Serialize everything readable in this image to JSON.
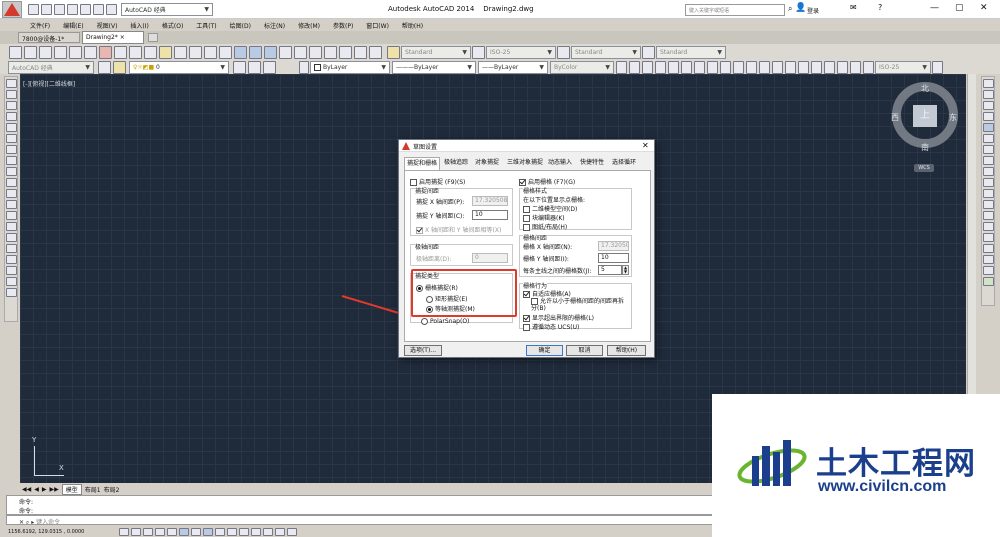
{
  "title_bar": {
    "app_title": "Autodesk AutoCAD 2014",
    "file_name": "Drawing2.dwg",
    "search_placeholder": "键入关键字或短语",
    "login_label": "登录"
  },
  "workspace_dropdown": "AutoCAD 经典",
  "menu": [
    "文件(F)",
    "编辑(E)",
    "视图(V)",
    "插入(I)",
    "格式(O)",
    "工具(T)",
    "绘图(D)",
    "标注(N)",
    "修改(M)",
    "参数(P)",
    "窗口(W)",
    "帮助(H)"
  ],
  "doc_tabs": [
    "7800@设备-1*",
    "Drawing2*"
  ],
  "styles_toolbar": {
    "text_style": "Standard",
    "dim_style": "ISO-25",
    "table_style": "Standard",
    "multileader_style": "Standard"
  },
  "layers_toolbar": {
    "workspace": "AutoCAD 经典",
    "layer": "0",
    "color": "ByLayer",
    "linetype": "ByLayer",
    "lineweight": "ByLayer",
    "plotstyle": "ByColor",
    "dim_style": "ISO-25"
  },
  "viewport_label": "[-][俯视][二维线框]",
  "viewcube": {
    "north": "北",
    "south": "南",
    "west": "西",
    "east": "东",
    "top": "上",
    "wcs": "WCS"
  },
  "ucs": {
    "x": "X",
    "y": "Y"
  },
  "layout_tabs": [
    "模型",
    "布局1",
    "布局2"
  ],
  "command_lines": [
    "命令:",
    "命令:"
  ],
  "command_prompt": "键入命令",
  "coordinates": "1156.6192, 129.0315 , 0.0000",
  "dialog": {
    "title": "草图设置",
    "tabs": [
      "捕捉和栅格",
      "极轴追踪",
      "对象捕捉",
      "三维对象捕捉",
      "动态输入",
      "快捷特性",
      "选择循环"
    ],
    "snap_on": "启用捕捉 (F9)(S)",
    "snap_spacing": "捕捉间距",
    "snap_x_label": "捕捉 X 轴间距(P):",
    "snap_x_value": "17.320508",
    "snap_y_label": "捕捉 Y 轴间距(C):",
    "snap_y_value": "10",
    "equal_xy": "X 轴间距和 Y 轴间距相等(X)",
    "polar_spacing": "极轴间距",
    "polar_distance_label": "极轴距离(D):",
    "polar_distance_value": "0",
    "snap_type": "捕捉类型",
    "grid_snap": "栅格捕捉(R)",
    "rect_snap": "矩形捕捉(E)",
    "iso_snap": "等轴测捕捉(M)",
    "polar_snap": "PolarSnap(O)",
    "grid_on": "启用栅格 (F7)(G)",
    "grid_style": "栅格样式",
    "grid_style_desc": "在以下位置显示点栅格:",
    "grid_2d_model": "二维模型空间(D)",
    "grid_block_editor": "块编辑器(K)",
    "grid_sheet": "图纸/布局(H)",
    "grid_spacing": "栅格间距",
    "grid_x_label": "栅格 X 轴间距(N):",
    "grid_x_value": "17.320508",
    "grid_y_label": "栅格 Y 轴间距(I):",
    "grid_y_value": "10",
    "major_label": "每条主线之间的栅格数(J):",
    "major_value": "5",
    "grid_behavior": "栅格行为",
    "adaptive": "自适应栅格(A)",
    "subdivide": "允许以小于栅格间距的间距再拆分(B)",
    "beyond_limits": "显示超出界限的栅格(L)",
    "follow_ucs": "遵循动态 UCS(U)",
    "options_btn": "选项(T)...",
    "ok_btn": "确定",
    "cancel_btn": "取消",
    "help_btn": "帮助(H)"
  },
  "watermark": {
    "title": "土木工程网",
    "url": "www.civilcn.com"
  },
  "colors": {
    "canvas": "#1f2a3a",
    "grid": "#2a3646",
    "accent_red": "#e03a2d",
    "watermark_blue": "#1b3f8c",
    "watermark_green": "#6ab42f"
  }
}
